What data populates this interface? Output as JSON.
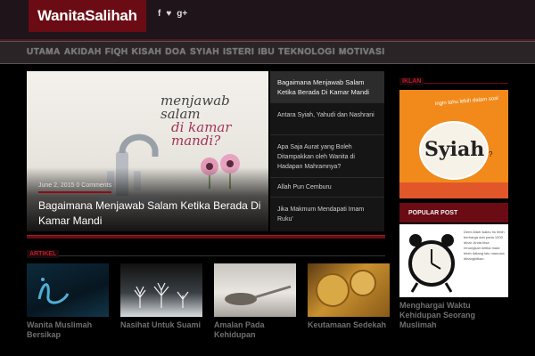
{
  "header": {
    "logo": "WanitaSalihah",
    "social": [
      "f",
      "♥",
      "g+"
    ]
  },
  "nav": {
    "items": [
      "UTAMA",
      "AKIDAH",
      "FIQH",
      "KISAH",
      "DOA",
      "SYIAH",
      "ISTERI",
      "IBU",
      "TEKNOLOGI",
      "MOTIVASI"
    ]
  },
  "hero": {
    "image_text_1": "menjawab salam",
    "image_text_2": "di kamar mandi?",
    "meta": "June 2, 2015  0 Comments",
    "title": "Bagaimana Menjawab Salam Ketika Berada Di Kamar Mandi"
  },
  "sidebar_list": [
    "Bagaimana Menjawab Salam Ketika Berada Di Kamar Mandi",
    "Antara Syiah, Yahudi dan Nashrani",
    "Apa Saja Aurat yang Boleh Ditampakkan oleh Wanita di Hadapan Mahramnya?",
    "Allah Pun Cemburu",
    "Jika Makmum Mendapati Imam Ruku'"
  ],
  "section": {
    "title": "ARTIKEL"
  },
  "thumbs": [
    {
      "caption": "Wanita Muslimah Bersikap"
    },
    {
      "caption": "Nasihat Untuk Suami"
    },
    {
      "caption": "Amalan Pada Kehidupan"
    },
    {
      "caption": "Keutamaan Sedekah"
    }
  ],
  "right": {
    "ad_head": "IKLAN",
    "ad_small": "ingin tahu lebih dalam soal",
    "ad_word": "Syiah",
    "ad_q": "?",
    "popular_label": "POPULAR POST",
    "pop_text": "Demi Allah waktu itu lebih berharga dari pada 1000 dinar. Anda bisa renungkan ketika maut telah datang lalu manusia dibangkitkan.",
    "pop_caption": "Menghargai Waktu Kehidupan Seorang Muslimah"
  },
  "colors": {
    "brand": "#6b0c14",
    "accent": "#c01828",
    "ad_orange": "#f28a1b"
  }
}
